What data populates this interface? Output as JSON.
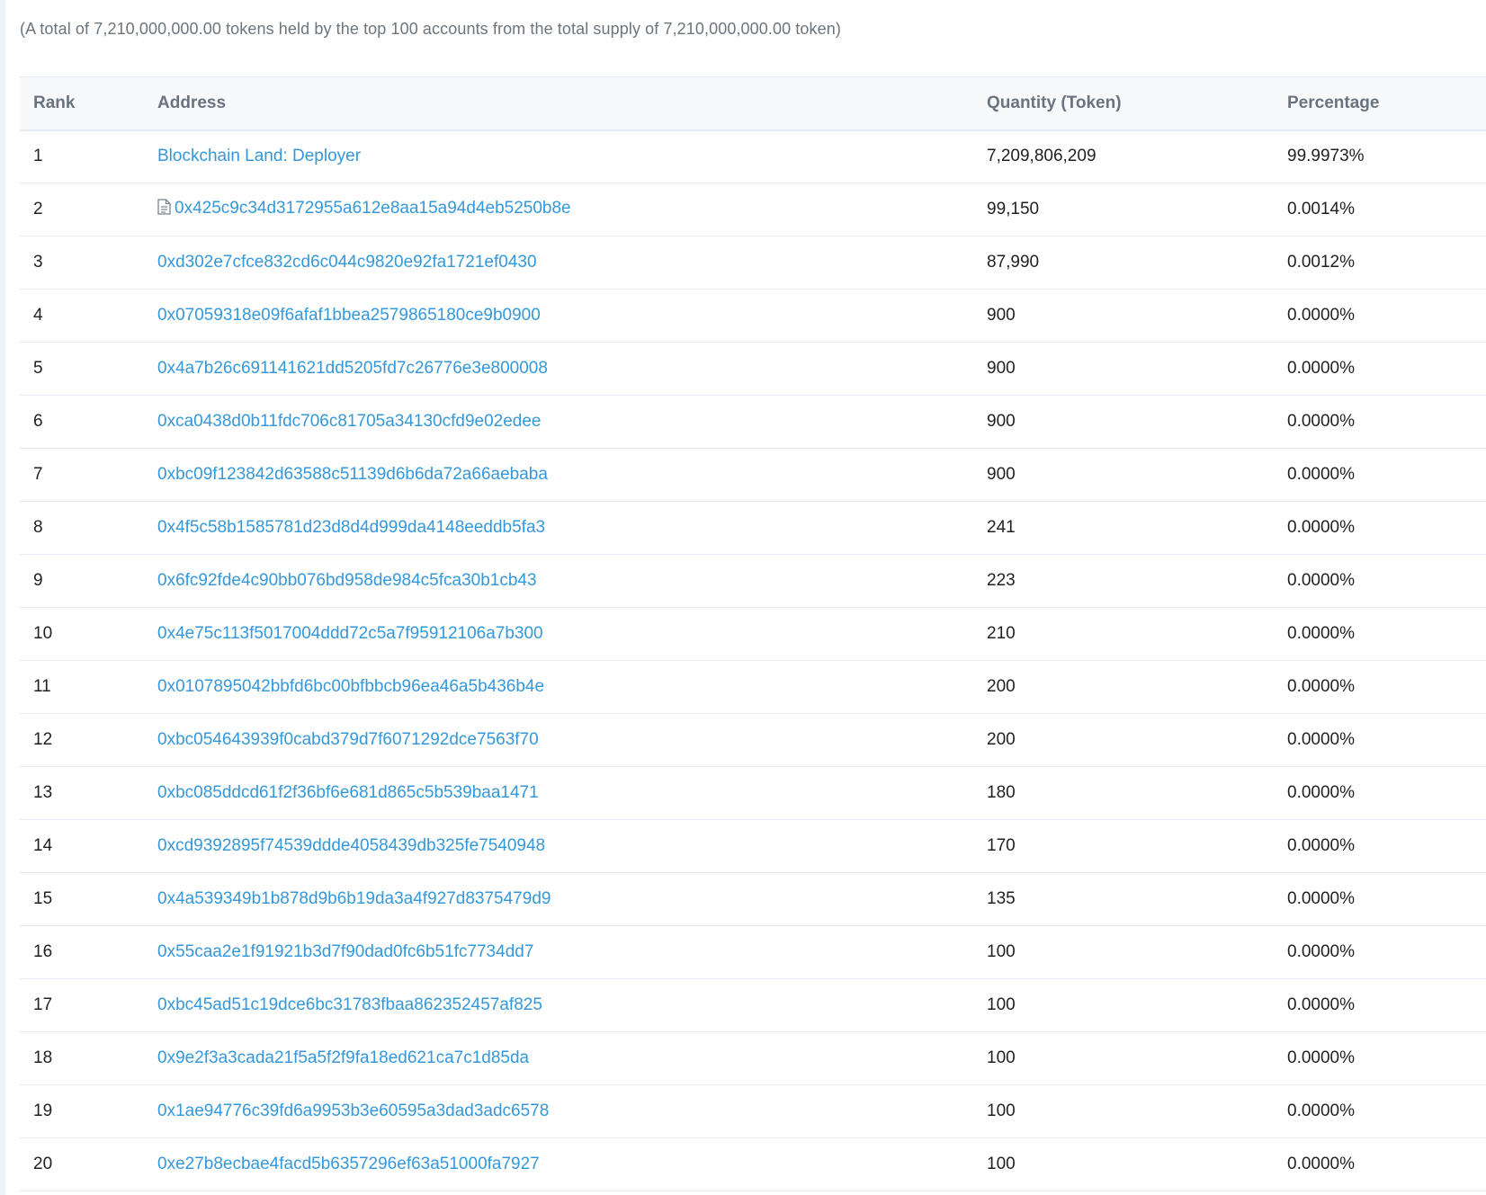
{
  "summary": "(A total of 7,210,000,000.00 tokens held by the top 100 accounts from the total supply of 7,210,000,000.00 token)",
  "table": {
    "headers": {
      "rank": "Rank",
      "address": "Address",
      "quantity": "Quantity (Token)",
      "percentage": "Percentage"
    },
    "rows": [
      {
        "rank": "1",
        "address": "Blockchain Land: Deployer",
        "quantity": "7,209,806,209",
        "percentage": "99.9973%",
        "contract": false
      },
      {
        "rank": "2",
        "address": "0x425c9c34d3172955a612e8aa15a94d4eb5250b8e",
        "quantity": "99,150",
        "percentage": "0.0014%",
        "contract": true
      },
      {
        "rank": "3",
        "address": "0xd302e7cfce832cd6c044c9820e92fa1721ef0430",
        "quantity": "87,990",
        "percentage": "0.0012%",
        "contract": false
      },
      {
        "rank": "4",
        "address": "0x07059318e09f6afaf1bbea2579865180ce9b0900",
        "quantity": "900",
        "percentage": "0.0000%",
        "contract": false
      },
      {
        "rank": "5",
        "address": "0x4a7b26c691141621dd5205fd7c26776e3e800008",
        "quantity": "900",
        "percentage": "0.0000%",
        "contract": false
      },
      {
        "rank": "6",
        "address": "0xca0438d0b11fdc706c81705a34130cfd9e02edee",
        "quantity": "900",
        "percentage": "0.0000%",
        "contract": false
      },
      {
        "rank": "7",
        "address": "0xbc09f123842d63588c51139d6b6da72a66aebaba",
        "quantity": "900",
        "percentage": "0.0000%",
        "contract": false
      },
      {
        "rank": "8",
        "address": "0x4f5c58b1585781d23d8d4d999da4148eeddb5fa3",
        "quantity": "241",
        "percentage": "0.0000%",
        "contract": false
      },
      {
        "rank": "9",
        "address": "0x6fc92fde4c90bb076bd958de984c5fca30b1cb43",
        "quantity": "223",
        "percentage": "0.0000%",
        "contract": false
      },
      {
        "rank": "10",
        "address": "0x4e75c113f5017004ddd72c5a7f95912106a7b300",
        "quantity": "210",
        "percentage": "0.0000%",
        "contract": false
      },
      {
        "rank": "11",
        "address": "0x0107895042bbfd6bc00bfbbcb96ea46a5b436b4e",
        "quantity": "200",
        "percentage": "0.0000%",
        "contract": false
      },
      {
        "rank": "12",
        "address": "0xbc054643939f0cabd379d7f6071292dce7563f70",
        "quantity": "200",
        "percentage": "0.0000%",
        "contract": false
      },
      {
        "rank": "13",
        "address": "0xbc085ddcd61f2f36bf6e681d865c5b539baa1471",
        "quantity": "180",
        "percentage": "0.0000%",
        "contract": false
      },
      {
        "rank": "14",
        "address": "0xcd9392895f74539ddde4058439db325fe7540948",
        "quantity": "170",
        "percentage": "0.0000%",
        "contract": false
      },
      {
        "rank": "15",
        "address": "0x4a539349b1b878d9b6b19da3a4f927d8375479d9",
        "quantity": "135",
        "percentage": "0.0000%",
        "contract": false
      },
      {
        "rank": "16",
        "address": "0x55caa2e1f91921b3d7f90dad0fc6b51fc7734dd7",
        "quantity": "100",
        "percentage": "0.0000%",
        "contract": false
      },
      {
        "rank": "17",
        "address": "0xbc45ad51c19dce6bc31783fbaa862352457af825",
        "quantity": "100",
        "percentage": "0.0000%",
        "contract": false
      },
      {
        "rank": "18",
        "address": "0x9e2f3a3cada21f5a5f2f9fa18ed621ca7c1d85da",
        "quantity": "100",
        "percentage": "0.0000%",
        "contract": false
      },
      {
        "rank": "19",
        "address": "0x1ae94776c39fd6a9953b3e60595a3dad3adc6578",
        "quantity": "100",
        "percentage": "0.0000%",
        "contract": false
      },
      {
        "rank": "20",
        "address": "0xe27b8ecbae4facd5b6357296ef63a51000fa7927",
        "quantity": "100",
        "percentage": "0.0000%",
        "contract": false
      }
    ]
  },
  "colors": {
    "link": "#3498db",
    "header_bg": "#f8f9fb",
    "border": "#e7eaf3",
    "muted_text": "#6c757d"
  },
  "icons": {
    "contract": "document-icon"
  }
}
